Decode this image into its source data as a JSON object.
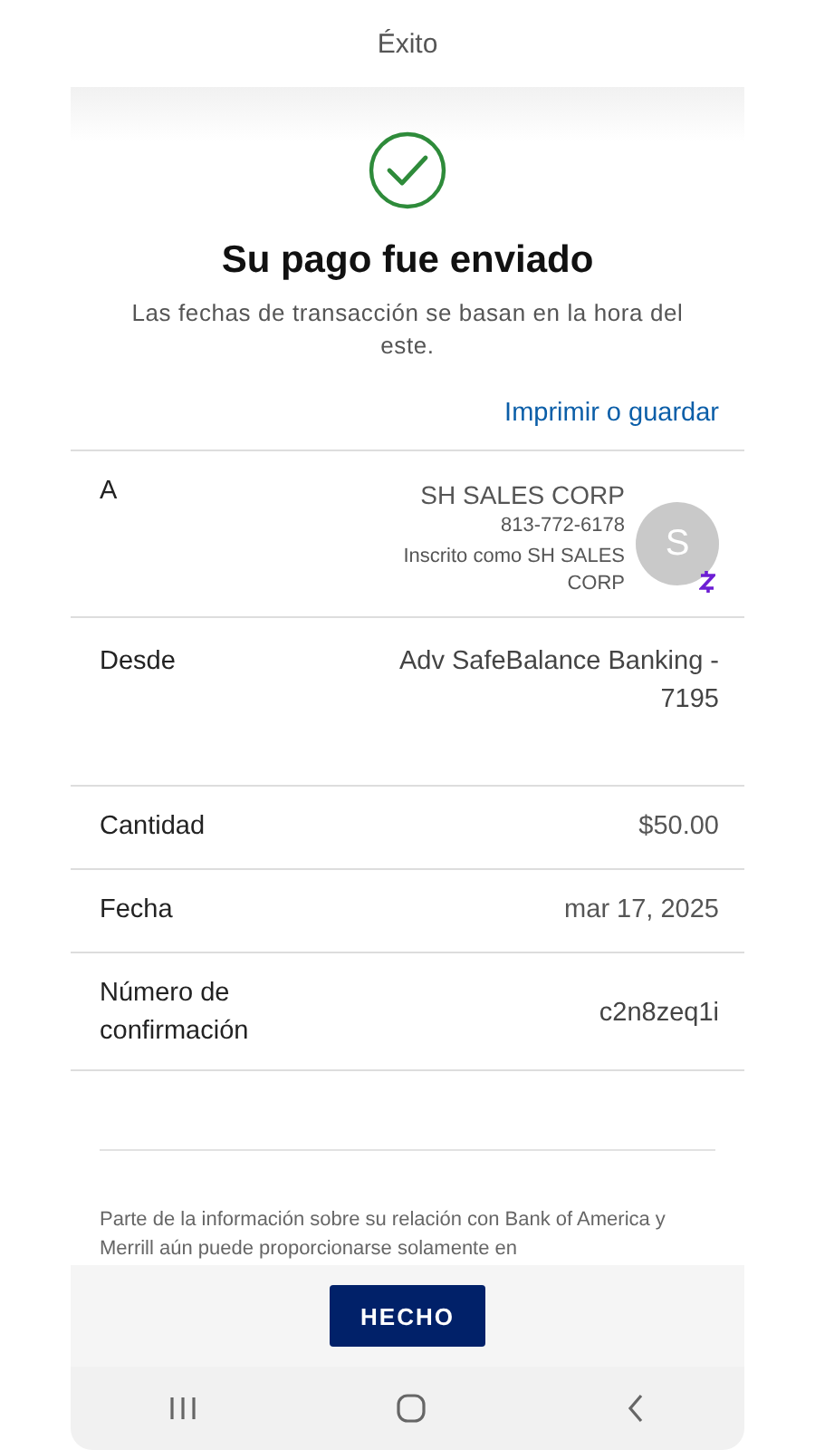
{
  "header": {
    "title": "Éxito"
  },
  "confirmation": {
    "title": "Su pago fue enviado",
    "subtitle": "Las fechas de transacción se basan en la hora del este.",
    "link": "Imprimir o guardar"
  },
  "recipient": {
    "label": "A",
    "name": "SH SALES CORP",
    "phone": "813-772-6178",
    "enrolled": "Inscrito como SH SALES CORP",
    "avatar": "S"
  },
  "details": [
    {
      "label": "Desde",
      "value": "Adv SafeBalance Banking - 7195"
    },
    {
      "label": "Cantidad",
      "value": "$50.00"
    },
    {
      "label": "Fecha",
      "value": "mar 17, 2025"
    },
    {
      "label": "Número de confirmación",
      "value": "c2n8zeq1i"
    }
  ],
  "disclaimer": "Parte de la información sobre su relación con Bank of America y Merrill aún puede proporcionarse solamente en",
  "done_button": "HECHO"
}
